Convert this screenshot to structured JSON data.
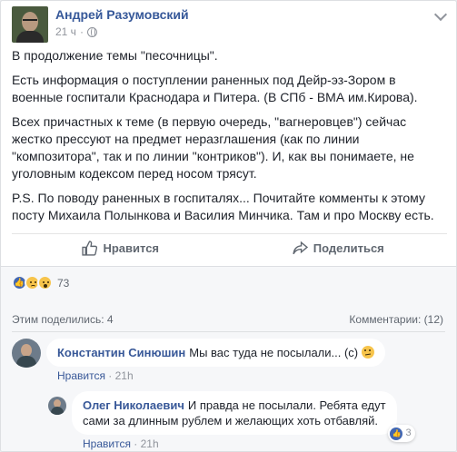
{
  "post": {
    "author": "Андрей Разумовский",
    "time": "21 ч",
    "paragraphs": [
      "В продолжение темы \"песочницы\".",
      "Есть информация о поступлении раненных под Дейр-эз-Зором в военные госпитали Краснодара и Питера. (В СПб - ВМА им.Кирова).",
      "Всех причастных к теме (в первую очередь, \"вагнеровцев\") сейчас жестко прессуют на предмет неразглашения (как по линии \"композитора\", так и по линии \"контриков\"). И, как вы понимаете, не уголовным кодексом перед носом трясут.",
      "P.S. По поводу раненных в госпиталях... Почитайте комменты к этому посту Михаила Полынкова и Василия Минчика. Там и про Москву есть."
    ]
  },
  "actions": {
    "like": "Нравится",
    "share": "Поделиться"
  },
  "feedback": {
    "reaction_count": "73",
    "reaction_icons": [
      "like-icon",
      "sad-icon",
      "wow-icon"
    ],
    "shared_text": "Этим поделились: 4",
    "comments_text": "Комментарии: (12)"
  },
  "comments": [
    {
      "name": "Константин Синюшин",
      "text": "Мы вас туда не посылали... (с)",
      "like_label": "Нравится",
      "time": "21h"
    },
    {
      "name": "Олег Николаевич",
      "text_line1": "И правда не посылали. Ребята едут",
      "text_line2": "сами за длинным рублем и желающих хоть отбавляй.",
      "like_label": "Нравится",
      "time": "21h",
      "reactions": "3"
    }
  ],
  "colors": {
    "link": "#365899",
    "meta": "#90949c",
    "like_blue": "#4267b2"
  }
}
